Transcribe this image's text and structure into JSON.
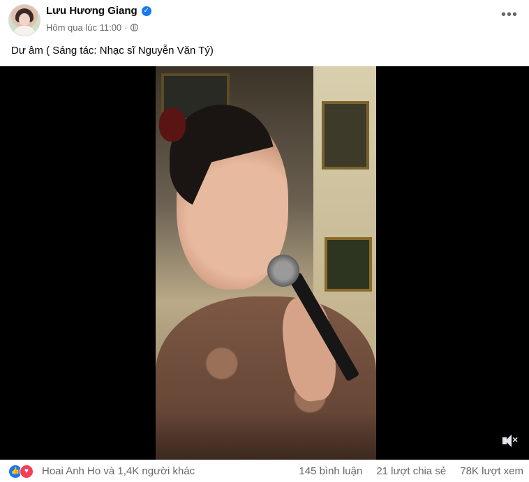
{
  "post": {
    "author": "Lưu Hương Giang",
    "timestamp": "Hôm qua lúc 11:00",
    "privacy_icon": "globe-icon",
    "text": "Dư âm ( Sáng tác: Nhạc sĩ Nguyễn Văn Tý)",
    "more_icon": "more-options-icon"
  },
  "video": {
    "mute_icon": "volume-muted-icon"
  },
  "footer": {
    "reactions_text": "Hoai Anh Ho và 1,4K người khác",
    "comments": "145 bình luận",
    "shares": "21 lượt chia sẻ",
    "views": "78K lượt xem"
  },
  "colors": {
    "accent": "#1877f2",
    "love": "#f33e58",
    "secondary_text": "#65676b"
  }
}
